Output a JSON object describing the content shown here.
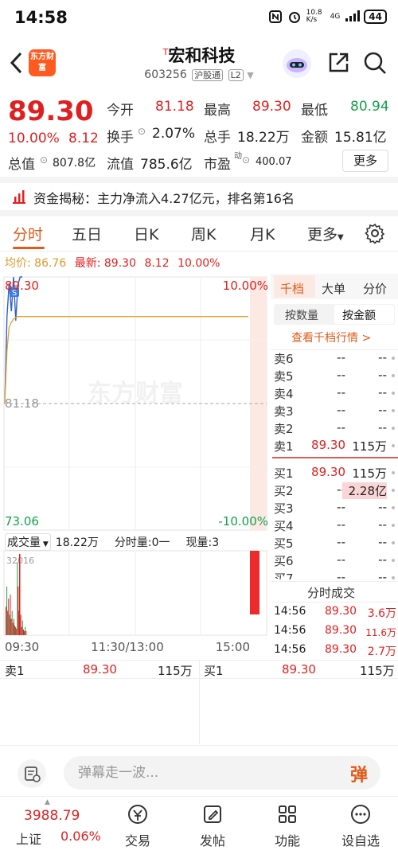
{
  "status_bar": {
    "time": "14:58",
    "net_speed": "10.8 K/s",
    "net_type": "4G",
    "battery": "44"
  },
  "header": {
    "logo_text": "东方财富",
    "stock_mark": "T",
    "stock_name": "宏和科技",
    "stock_code": "603256",
    "tag_connect": "沪股通",
    "tag_level": "L2"
  },
  "quote": {
    "price": "89.30",
    "change_pct": "10.00%",
    "change": "8.12",
    "open_label": "今开",
    "open": "81.18",
    "high_label": "最高",
    "high": "89.30",
    "low_label": "最低",
    "low": "80.94",
    "turnover_label": "换手",
    "turnover": "2.07%",
    "volume_label": "总手",
    "volume": "18.22万",
    "amount_label": "金额",
    "amount": "15.81亿",
    "mktcap_label": "总值",
    "mktcap": "807.8亿",
    "float_label": "流值",
    "float_cap": "785.6亿",
    "pe_label": "市盈",
    "pe_sup": "动",
    "pe": "400.07",
    "more_label": "更多"
  },
  "capflow": {
    "text": "资金揭秘：主力净流入4.27亿元，排名第16名"
  },
  "tabs": [
    "分时",
    "五日",
    "日K",
    "周K",
    "月K",
    "更多"
  ],
  "avg_line": {
    "avg_label": "均价:",
    "avg": "86.76",
    "latest_label": "最新:",
    "latest": "89.30",
    "change": "8.12",
    "pct": "10.00%"
  },
  "chart": {
    "top_price": "89.30",
    "top_pct": "10.00%",
    "mid_price": "81.18",
    "bottom_price": "73.06",
    "bottom_pct": "-10.00%",
    "vol_label": "成交量",
    "vol_total": "18.22万",
    "fenshi_label": "分时量:0一",
    "current_label": "现量:3",
    "vol_max": "32016",
    "time_start": "09:30",
    "time_mid": "11:30/13:00",
    "time_end": "15:00",
    "watermark": "东方财富"
  },
  "chart_data": {
    "type": "line",
    "title": "",
    "ylim": [
      73.06,
      89.3
    ],
    "y_ticks": [
      89.3,
      81.18,
      73.06
    ],
    "x_ticks": [
      "09:30",
      "11:30/13:00",
      "15:00"
    ],
    "series": [
      {
        "name": "价格",
        "color": "#2a62c9",
        "values": [
          81.18,
          86.8,
          88.9,
          87.1,
          89.3,
          86.5,
          88.8,
          89.3,
          89.3
        ]
      },
      {
        "name": "均价",
        "color": "#e8a23a",
        "values": [
          81.18,
          84.6,
          86.1,
          86.4,
          86.6,
          86.7,
          86.76,
          86.76,
          86.76
        ]
      }
    ],
    "volume_max": 32016
  },
  "book": {
    "tabs": [
      "千档",
      "大单",
      "分价"
    ],
    "sub_tabs": [
      "按数量",
      "按金额"
    ],
    "view_more": "查看千档行情 >",
    "sells": [
      {
        "label": "卖6",
        "price": "--",
        "vol": "--"
      },
      {
        "label": "卖5",
        "price": "--",
        "vol": "--"
      },
      {
        "label": "卖4",
        "price": "--",
        "vol": "--"
      },
      {
        "label": "卖3",
        "price": "--",
        "vol": "--"
      },
      {
        "label": "卖2",
        "price": "--",
        "vol": "--"
      },
      {
        "label": "卖1",
        "price": "89.30",
        "vol": "115万"
      }
    ],
    "buys": [
      {
        "label": "买1",
        "price": "89.30",
        "vol": "115万"
      },
      {
        "label": "买2",
        "price": "--",
        "vol": "2.28亿"
      },
      {
        "label": "买3",
        "price": "--",
        "vol": "--"
      },
      {
        "label": "买4",
        "price": "--",
        "vol": "--"
      },
      {
        "label": "买5",
        "price": "--",
        "vol": "--"
      },
      {
        "label": "买6",
        "price": "--",
        "vol": "--"
      },
      {
        "label": "买7",
        "price": "--",
        "vol": "--"
      }
    ],
    "trades_title": "分时成交",
    "trades": [
      {
        "time": "14:56",
        "price": "89.30",
        "vol": "3.6万"
      },
      {
        "time": "14:56",
        "price": "89.30",
        "vol": "11.6万"
      },
      {
        "time": "14:56",
        "price": "89.30",
        "vol": "2.7万"
      }
    ]
  },
  "strip": {
    "sell_label": "卖1",
    "sell_price": "89.30",
    "sell_vol": "115万",
    "buy_label": "买1",
    "buy_price": "89.30",
    "buy_vol": "115万"
  },
  "danmu": {
    "placeholder": "弹幕走一波...",
    "button": "弹"
  },
  "bottom_nav": {
    "index_value": "3988.79",
    "index_name": "上证",
    "index_pct": "0.06%",
    "items": [
      "交易",
      "发帖",
      "功能",
      "设自选"
    ]
  }
}
